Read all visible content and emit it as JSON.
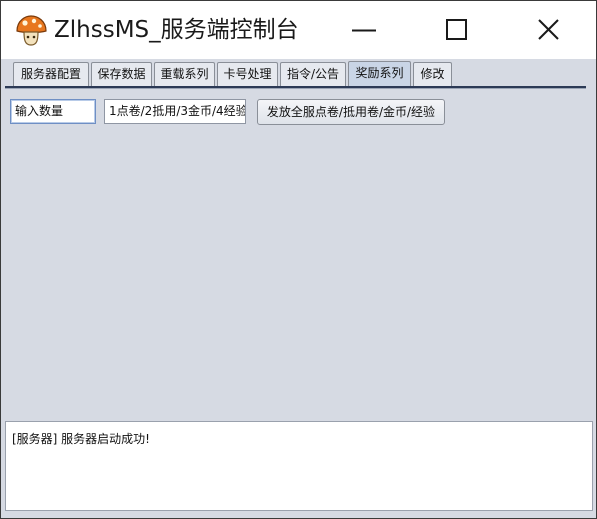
{
  "window": {
    "title": "ZlhssMS_服务端控制台",
    "icon": "mushroom-icon"
  },
  "window_controls": {
    "minimize_icon": "minimize-icon",
    "maximize_icon": "maximize-icon",
    "close_icon": "close-icon"
  },
  "tabs": [
    {
      "label": "服务器配置"
    },
    {
      "label": "保存数据"
    },
    {
      "label": "重载系列"
    },
    {
      "label": "卡号处理"
    },
    {
      "label": "指令/公告"
    },
    {
      "label": "奖励系列"
    },
    {
      "label": "修改"
    }
  ],
  "selected_tab": "奖励系列",
  "reward_panel": {
    "quantity_value": "输入数量",
    "type_value": "1点卷/2抵用/3金币/4经验",
    "send_button_label": "发放全服点卷/抵用卷/金币/经验"
  },
  "log": {
    "text": "[服务器] 服务器启动成功!"
  },
  "colors": {
    "panel_background": "#d6dae3",
    "selected_tab": "#c9d5e6",
    "tab_rule": "#2c3a56"
  }
}
